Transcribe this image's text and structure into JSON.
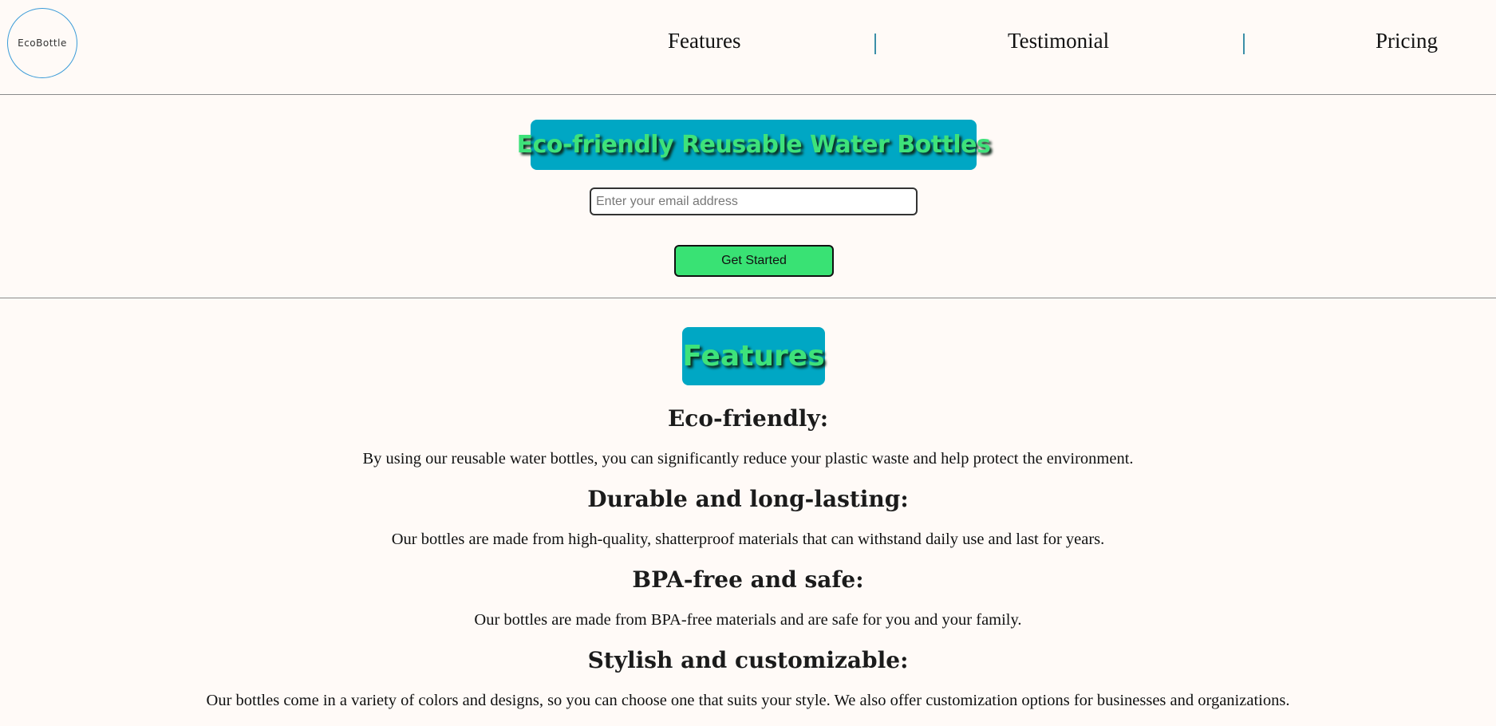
{
  "header": {
    "logo_text": "EcoBottle",
    "nav": [
      {
        "label": "Features"
      },
      {
        "label": "Testimonial"
      },
      {
        "label": "Pricing"
      }
    ]
  },
  "hero": {
    "title": "Eco-friendly Reusable Water Bottles",
    "email_placeholder": "Enter your email address",
    "email_value": "",
    "cta_label": "Get Started"
  },
  "features": {
    "title": "Features",
    "items": [
      {
        "heading": "Eco-friendly:",
        "description": "By using our reusable water bottles, you can significantly reduce your plastic waste and help protect the environment."
      },
      {
        "heading": "Durable and long-lasting:",
        "description": "Our bottles are made from high-quality, shatterproof materials that can withstand daily use and last for years."
      },
      {
        "heading": "BPA-free and safe:",
        "description": "Our bottles are made from BPA-free materials and are safe for you and your family."
      },
      {
        "heading": "Stylish and customizable:",
        "description": "Our bottles come in a variety of colors and designs, so you can choose one that suits your style. We also offer customization options for businesses and organizations."
      }
    ]
  },
  "colors": {
    "background": "#fffaf7",
    "title_box": "#00a7c4",
    "title_text": "#3ee27a",
    "cta_button": "#39e274",
    "logo_border": "#3a9bd8",
    "nav_separator": "#3c8fa8"
  }
}
